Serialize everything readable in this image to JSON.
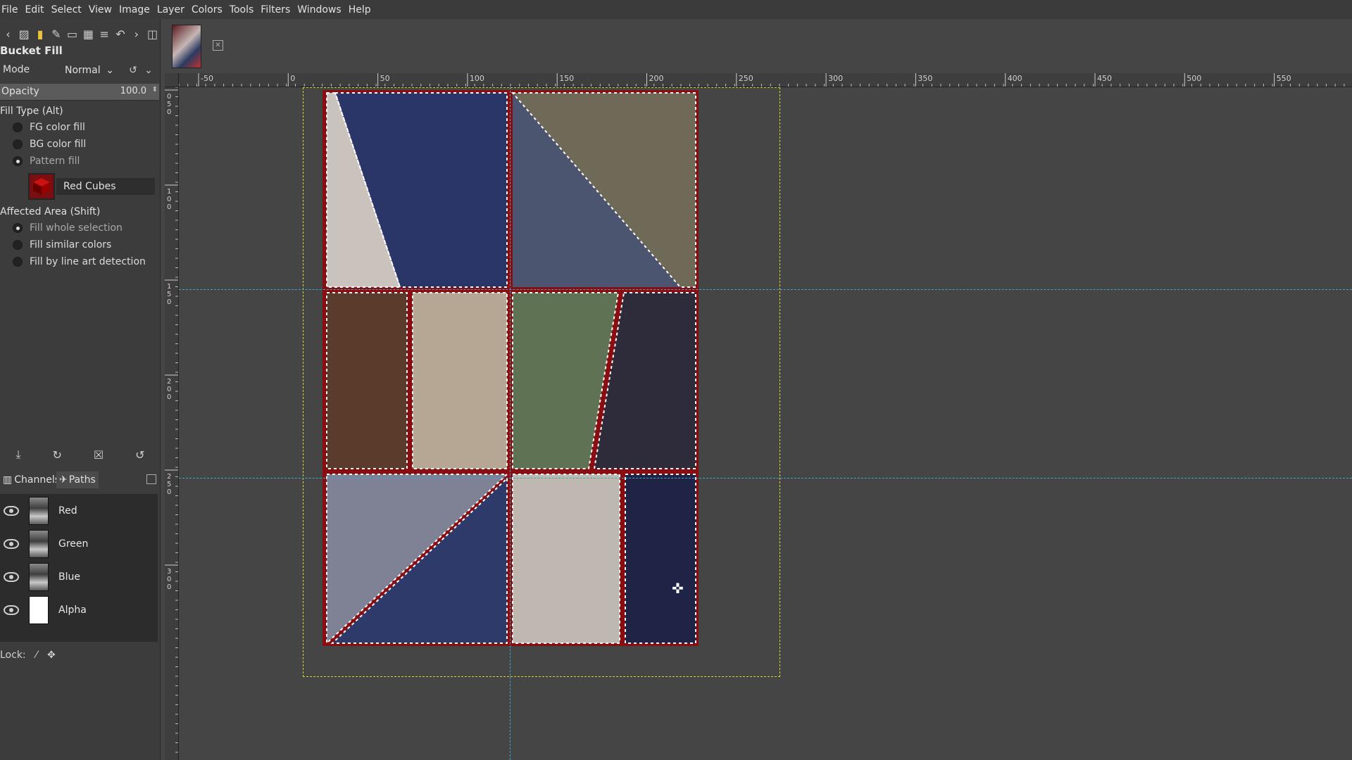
{
  "menu": [
    "File",
    "Edit",
    "Select",
    "View",
    "Image",
    "Layer",
    "Colors",
    "Tools",
    "Filters",
    "Windows",
    "Help"
  ],
  "tool_options": {
    "title": "Bucket Fill",
    "mode_label": "Mode",
    "mode_value": "Normal",
    "opacity_label": "Opacity",
    "opacity_value": "100.0",
    "opacity_fraction": 1.0,
    "fill_type_label": "Fill Type  (Alt)",
    "fill_types": [
      "FG color fill",
      "BG color fill",
      "Pattern fill"
    ],
    "fill_type_selected": "Pattern fill",
    "pattern_name": "Red Cubes",
    "affected_area_label": "Affected Area  (Shift)",
    "affected_areas": [
      "Fill whole selection",
      "Fill similar colors",
      "Fill by line art detection"
    ],
    "affected_area_selected": "Fill whole selection"
  },
  "dock_tabs": {
    "channels": "Channels",
    "paths": "Paths"
  },
  "channels": [
    {
      "name": "Red"
    },
    {
      "name": "Green"
    },
    {
      "name": "Blue"
    },
    {
      "name": "Alpha"
    }
  ],
  "lock_label": "Lock:",
  "ruler": {
    "horizontal": [
      "-50",
      "0",
      "50",
      "100",
      "150",
      "200",
      "250",
      "300",
      "350",
      "400",
      "450",
      "500",
      "550"
    ],
    "vertical": [
      "0",
      "5",
      "0",
      "1",
      "0",
      "0",
      "1",
      "5",
      "0",
      "2",
      "0",
      "0",
      "2",
      "5",
      "0",
      "3",
      "0",
      "0"
    ]
  },
  "colors": {
    "frame_red": "#8a0d12",
    "guide_blue": "#3fa6c8",
    "layer_boundary_yellow": "#d5d533"
  },
  "icons": [
    "move-tool-icon",
    "paint-icon",
    "text-icon",
    "eye-icon",
    "lock-pixels-icon",
    "lock-position-icon",
    "save-icon",
    "restore-icon",
    "delete-icon",
    "reset-icon",
    "move-cursor-icon"
  ]
}
